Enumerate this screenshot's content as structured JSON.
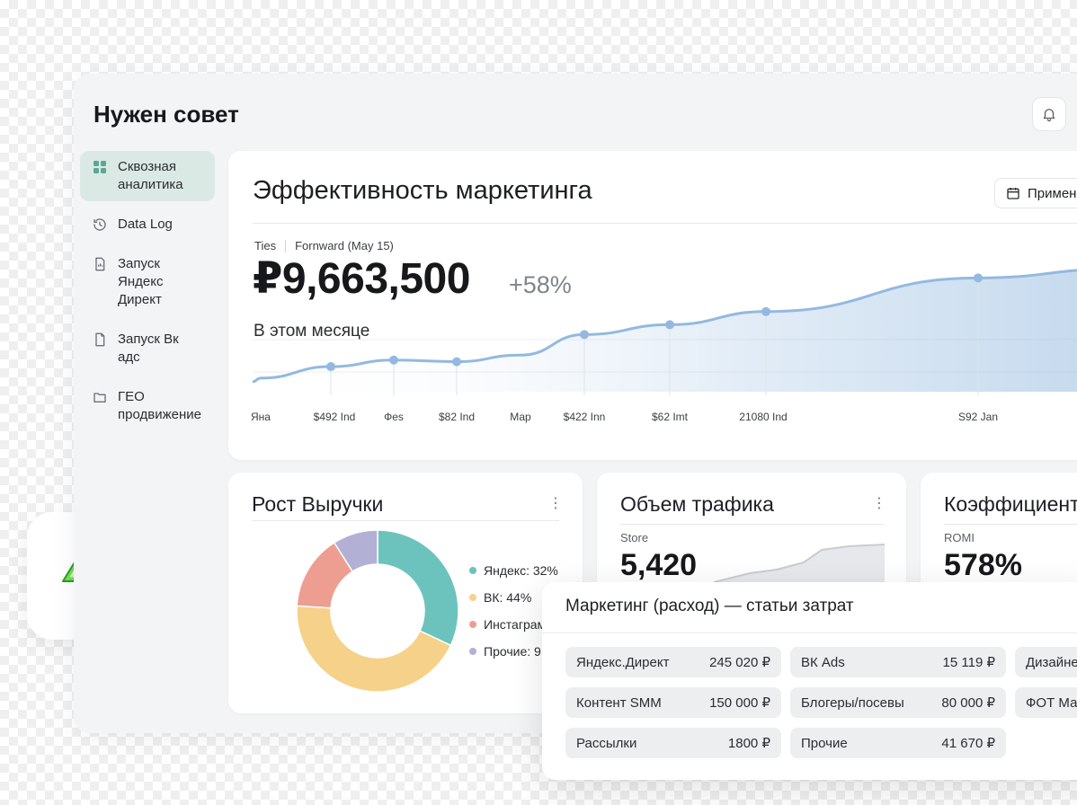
{
  "app": {
    "title": "Нужен совет"
  },
  "sidebar": {
    "items": [
      {
        "label": "Сквозная аналитика",
        "icon": "grid-icon",
        "active": true
      },
      {
        "label": "Data Log",
        "icon": "history-icon",
        "active": false
      },
      {
        "label": "Запуск Яндекс Директ",
        "icon": "document-chart-icon",
        "active": false
      },
      {
        "label": "Запуск Вк адс",
        "icon": "document-icon",
        "active": false
      },
      {
        "label": "ГЕО продвижение",
        "icon": "folder-icon",
        "active": false
      }
    ]
  },
  "main": {
    "title": "Эффективность маркетинга",
    "apply_label": "Примен",
    "tabs": [
      "Ties",
      "Fornward (May 15)"
    ],
    "value": "₽9,663,500",
    "growth": "+58%",
    "period": "В этом месяце"
  },
  "chart_data": [
    {
      "type": "area",
      "x": [
        "Яна",
        "$492 Ind",
        "Фes",
        "$82 Ind",
        "Мар",
        "$422 Inn",
        "$62 Imt",
        "21080 Ind",
        "S92 Jan"
      ],
      "series": [
        {
          "values": [
            10,
            24,
            32,
            30,
            38,
            63,
            75,
            91,
            132
          ]
        }
      ],
      "color": "#93b9df"
    },
    {
      "type": "pie",
      "title": "Рост Выручки",
      "labels": [
        "Яндекс: 32%",
        "ВК: 44%",
        "Инстаграм",
        "Прочие: 9"
      ],
      "values": [
        32,
        44,
        15,
        9
      ],
      "colors": [
        "#6cc3bd",
        "#f6d18a",
        "#ee9d91",
        "#b3b0d5"
      ]
    }
  ],
  "revenue_card": {
    "title": "Рост Выручки",
    "menu_icon": "more-vertical-icon",
    "legend": [
      {
        "label": "Яндекс: 32%",
        "color": "#6cc3bd"
      },
      {
        "label": "ВК: 44%",
        "color": "#f6d18a"
      },
      {
        "label": "Инстаграм",
        "color": "#ee9d91"
      },
      {
        "label": "Прочие: 9",
        "color": "#b3b0d5"
      }
    ]
  },
  "traffic_card": {
    "title": "Объем трафика",
    "menu_icon": "more-vertical-icon",
    "label": "Store",
    "value": "5,420"
  },
  "coef_card": {
    "title": "Коэффициент",
    "label": "ROMI",
    "value": "578%"
  },
  "expenses": {
    "title": "Маркетинг (расход) — статьи затрат",
    "items": [
      {
        "name": "Яндекс.Директ",
        "amount": "245 020 ₽"
      },
      {
        "name": "ВК Ads",
        "amount": "15 119 ₽"
      },
      {
        "name": "Дизайне",
        "amount": ""
      },
      {
        "name": "Контент SMM",
        "amount": "150 000 ₽"
      },
      {
        "name": "Блогеры/посевы",
        "amount": "80 000 ₽"
      },
      {
        "name": "ФОТ Ма",
        "amount": ""
      },
      {
        "name": "Рассылки",
        "amount": "1800 ₽"
      },
      {
        "name": "Прочие",
        "amount": "41 670 ₽"
      }
    ]
  },
  "colors": {
    "accent_green": "#dbe9e4",
    "chart_line": "#93b9df",
    "bolt": "#4fd13a"
  }
}
